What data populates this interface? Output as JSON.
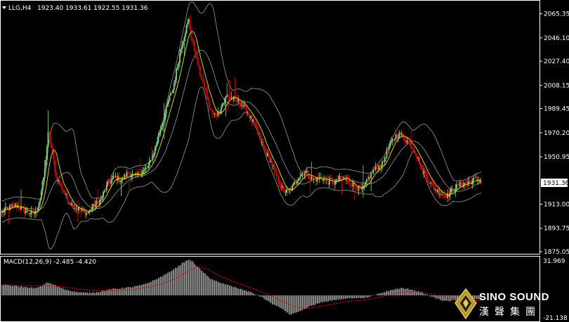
{
  "header": {
    "symbol_tf": "LLG,H4",
    "ohlc": "1923.40 1933.61 1922.55 1931.36"
  },
  "price_axis": {
    "ticks": [
      "2065.35",
      "2046.10",
      "2027.40",
      "2008.15",
      "1989.45",
      "1970.20",
      "1950.95",
      "1913.00",
      "1893.75",
      "1875.05"
    ],
    "current": "1931.36"
  },
  "macd": {
    "label": "MACD(12,26,9) -2.485 -4.420",
    "max_label": "31.969",
    "min_label": "-21.138"
  },
  "logo": {
    "brand": "SINO SOUND",
    "brand_cn": "漢聲集團"
  },
  "colors": {
    "background": "#000000",
    "bull": "#7fd47f",
    "bear": "#e00000",
    "ma": "#e8e800",
    "bands": "#9a9a9a",
    "signal": "#e00000"
  },
  "chart_data": [
    {
      "type": "candlestick",
      "title": "LLG,H4",
      "ylim": [
        1875.05,
        2073
      ],
      "ma_visible": true,
      "bollinger_visible": true,
      "close_path": [
        [
          0,
          1907
        ],
        [
          6,
          1910
        ],
        [
          12,
          1912
        ],
        [
          18,
          1909
        ],
        [
          24,
          1906
        ],
        [
          30,
          1906
        ],
        [
          34,
          1918
        ],
        [
          38,
          1940
        ],
        [
          41,
          1969
        ],
        [
          44,
          1958
        ],
        [
          48,
          1935
        ],
        [
          54,
          1925
        ],
        [
          58,
          1917
        ],
        [
          64,
          1911
        ],
        [
          70,
          1908
        ],
        [
          76,
          1906
        ],
        [
          82,
          1912
        ],
        [
          88,
          1917
        ],
        [
          94,
          1929
        ],
        [
          100,
          1935
        ],
        [
          106,
          1932
        ],
        [
          112,
          1938
        ],
        [
          118,
          1935
        ],
        [
          124,
          1938
        ],
        [
          130,
          1943
        ],
        [
          136,
          1957
        ],
        [
          140,
          1971
        ],
        [
          144,
          1982
        ],
        [
          148,
          1996
        ],
        [
          152,
          2005
        ],
        [
          156,
          2024
        ],
        [
          160,
          2042
        ],
        [
          164,
          2055
        ],
        [
          166,
          2060
        ],
        [
          168,
          2048
        ],
        [
          172,
          2033
        ],
        [
          176,
          2017
        ],
        [
          180,
          2007
        ],
        [
          184,
          1991
        ],
        [
          188,
          1984
        ],
        [
          192,
          1986
        ],
        [
          196,
          1993
        ],
        [
          200,
          2000
        ],
        [
          206,
          1997
        ],
        [
          212,
          1994
        ],
        [
          218,
          1987
        ],
        [
          222,
          1980
        ],
        [
          226,
          1974
        ],
        [
          230,
          1964
        ],
        [
          234,
          1955
        ],
        [
          238,
          1949
        ],
        [
          242,
          1940
        ],
        [
          246,
          1931
        ],
        [
          250,
          1924
        ],
        [
          254,
          1923
        ],
        [
          258,
          1926
        ],
        [
          262,
          1933
        ],
        [
          266,
          1937
        ],
        [
          270,
          1939
        ],
        [
          274,
          1934
        ],
        [
          278,
          1933
        ],
        [
          284,
          1934
        ],
        [
          290,
          1931
        ],
        [
          296,
          1930
        ],
        [
          302,
          1935
        ],
        [
          308,
          1931
        ],
        [
          314,
          1927
        ],
        [
          320,
          1924
        ],
        [
          326,
          1934
        ],
        [
          330,
          1940
        ],
        [
          334,
          1943
        ],
        [
          338,
          1945
        ],
        [
          342,
          1955
        ],
        [
          346,
          1962
        ],
        [
          350,
          1968
        ],
        [
          354,
          1969
        ],
        [
          358,
          1965
        ],
        [
          362,
          1962
        ],
        [
          366,
          1957
        ],
        [
          370,
          1949
        ],
        [
          374,
          1940
        ],
        [
          378,
          1934
        ],
        [
          382,
          1928
        ],
        [
          386,
          1924
        ],
        [
          390,
          1922
        ],
        [
          396,
          1920
        ],
        [
          402,
          1926
        ],
        [
          408,
          1929
        ],
        [
          414,
          1930
        ],
        [
          420,
          1933
        ],
        [
          426,
          1931.36
        ]
      ]
    },
    {
      "type": "bar",
      "title": "MACD(12,26,9)",
      "ylim": [
        -21.138,
        31.969
      ],
      "macd_path": [
        [
          0,
          9
        ],
        [
          10,
          8
        ],
        [
          20,
          7
        ],
        [
          30,
          6
        ],
        [
          36,
          8
        ],
        [
          40,
          11
        ],
        [
          46,
          9
        ],
        [
          56,
          5
        ],
        [
          66,
          3
        ],
        [
          76,
          2
        ],
        [
          86,
          3
        ],
        [
          96,
          5
        ],
        [
          106,
          6
        ],
        [
          116,
          7
        ],
        [
          126,
          9
        ],
        [
          136,
          13
        ],
        [
          146,
          18
        ],
        [
          156,
          24
        ],
        [
          162,
          28
        ],
        [
          166,
          30
        ],
        [
          170,
          28
        ],
        [
          176,
          22
        ],
        [
          184,
          15
        ],
        [
          192,
          11
        ],
        [
          200,
          9
        ],
        [
          210,
          6
        ],
        [
          220,
          3
        ],
        [
          230,
          -1
        ],
        [
          240,
          -7
        ],
        [
          250,
          -12
        ],
        [
          256,
          -16
        ],
        [
          264,
          -14
        ],
        [
          274,
          -9
        ],
        [
          284,
          -6
        ],
        [
          294,
          -4
        ],
        [
          304,
          -3
        ],
        [
          314,
          -2
        ],
        [
          324,
          -2
        ],
        [
          334,
          1
        ],
        [
          344,
          4
        ],
        [
          354,
          6
        ],
        [
          364,
          5
        ],
        [
          374,
          2
        ],
        [
          384,
          -2
        ],
        [
          394,
          -5
        ],
        [
          404,
          -4
        ],
        [
          414,
          -4
        ],
        [
          426,
          -2.485
        ]
      ],
      "signal_path": [
        [
          0,
          9
        ],
        [
          20,
          8
        ],
        [
          40,
          8
        ],
        [
          56,
          7
        ],
        [
          70,
          5
        ],
        [
          84,
          4
        ],
        [
          100,
          4
        ],
        [
          116,
          5
        ],
        [
          130,
          7
        ],
        [
          144,
          10
        ],
        [
          156,
          15
        ],
        [
          166,
          21
        ],
        [
          174,
          24
        ],
        [
          182,
          22
        ],
        [
          192,
          17
        ],
        [
          204,
          12
        ],
        [
          216,
          8
        ],
        [
          228,
          4
        ],
        [
          240,
          -1
        ],
        [
          252,
          -6
        ],
        [
          262,
          -10
        ],
        [
          272,
          -11
        ],
        [
          284,
          -9
        ],
        [
          296,
          -7
        ],
        [
          308,
          -5
        ],
        [
          320,
          -4
        ],
        [
          334,
          -2
        ],
        [
          346,
          1
        ],
        [
          358,
          3
        ],
        [
          370,
          3
        ],
        [
          382,
          1
        ],
        [
          396,
          -2
        ],
        [
          410,
          -4
        ],
        [
          426,
          -4.42
        ]
      ]
    }
  ]
}
